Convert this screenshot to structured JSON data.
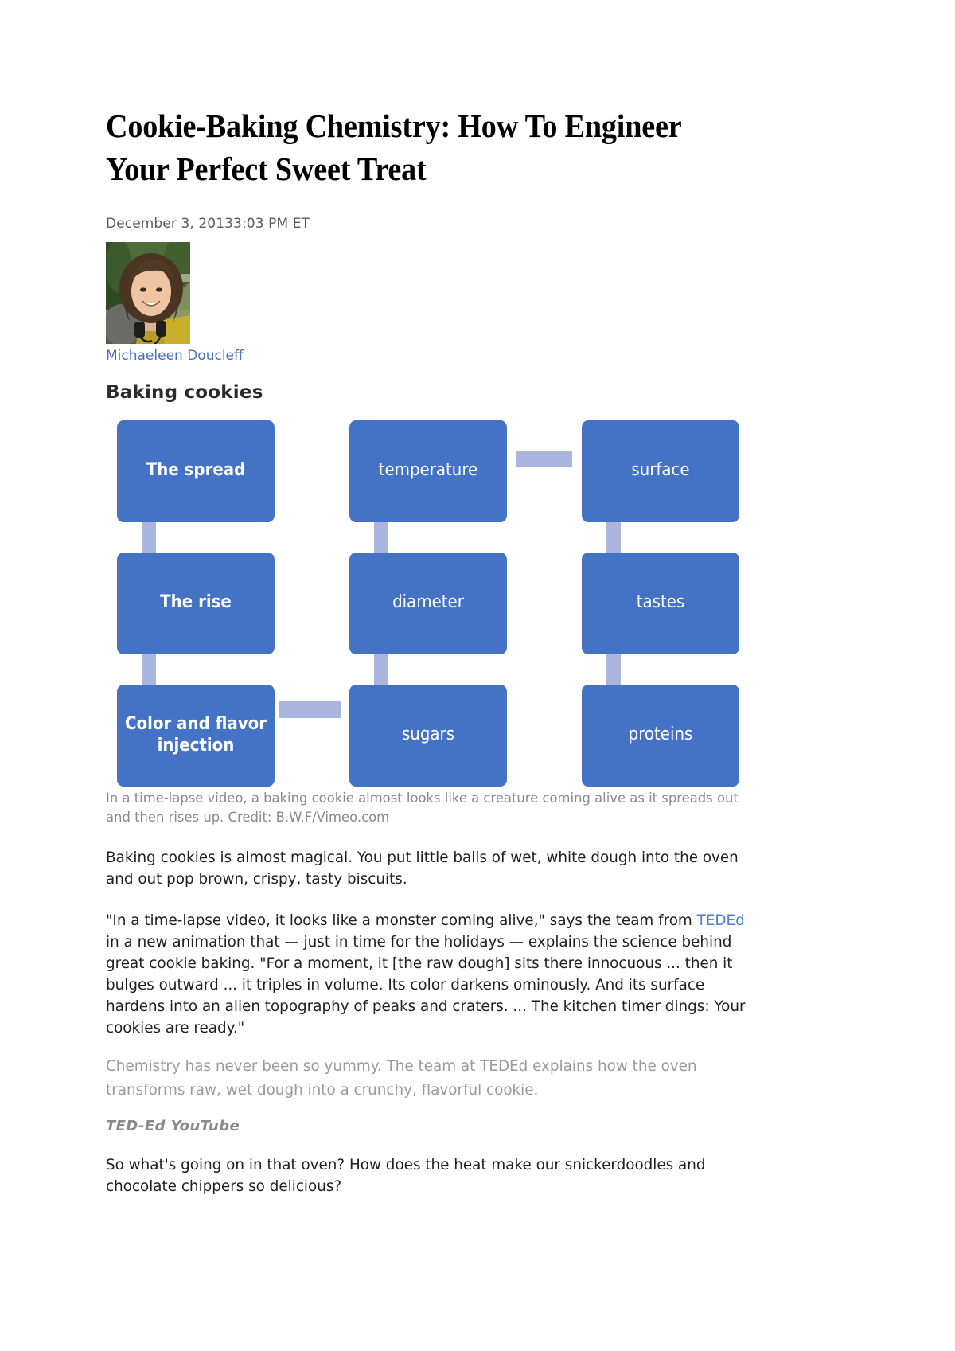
{
  "article": {
    "headline": "Cookie-Baking Chemistry: How To Engineer Your Perfect Sweet Treat",
    "dateline": "December 3, 20133:03 PM ET",
    "byline": {
      "name": "Michaeleen Doucleff",
      "avatar_alt": "Portrait photo of Michaeleen Doucleff"
    },
    "caption": "In a time-lapse video, a baking cookie almost looks like a creature coming alive as it spreads out and then rises up. Credit: B.W.F/Vimeo.com",
    "paragraphs": {
      "p1": "Baking cookies is almost magical. You put little balls of wet, white dough into the oven and out pop brown, crispy, tasty biscuits.",
      "p2_a": "\"In a time-lapse video, it looks like a monster coming alive,\" says the team from ",
      "p2_link": "TEDEd",
      "p2_b": " in a new animation that — just in time for the holidays — explains the science behind great cookie baking. \"For a moment, it [the raw dough] sits there innocuous ... then it bulges outward ... it triples in volume. Its color darkens ominously. And its surface hardens into an alien topography of peaks and craters. ... The kitchen timer dings: Your cookies are ready.\"",
      "p3_muted": "Chemistry has never been so yummy. The team at TEDEd explains how the oven transforms raw, wet dough into a crunchy, flavorful cookie.",
      "credit": "TED-Ed YouTube",
      "p4": "So what's going on in that oven? How does the heat make our snickerdoodles and chocolate chippers so delicious?"
    }
  },
  "diagram": {
    "title": "Baking cookies",
    "accent_color": "#4472c4",
    "connector_color": "#aab6e0",
    "nodes": [
      {
        "id": "spread",
        "label": "The spread",
        "bold": true
      },
      {
        "id": "temperature",
        "label": "temperature",
        "bold": false
      },
      {
        "id": "surface",
        "label": "surface",
        "bold": false
      },
      {
        "id": "rise",
        "label": "The rise",
        "bold": true
      },
      {
        "id": "diameter",
        "label": "diameter",
        "bold": false
      },
      {
        "id": "tastes",
        "label": "tastes",
        "bold": false
      },
      {
        "id": "color",
        "label": "Color and flavor injection",
        "bold": true
      },
      {
        "id": "sugars",
        "label": "sugars",
        "bold": false
      },
      {
        "id": "proteins",
        "label": "proteins",
        "bold": false
      }
    ]
  }
}
